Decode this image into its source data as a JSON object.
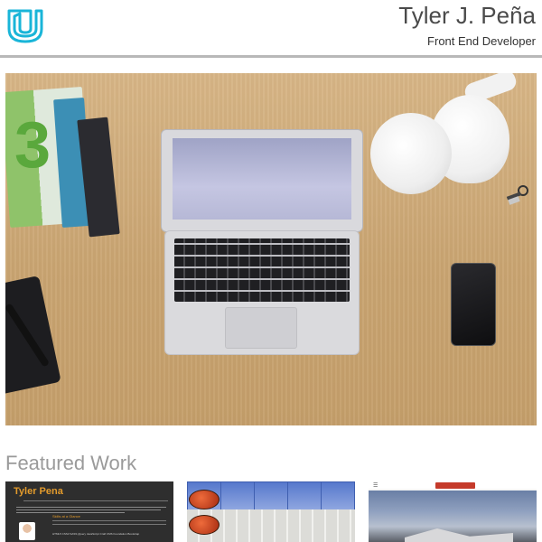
{
  "header": {
    "name": "Tyler J. Peña",
    "role": "Front End Developer",
    "logo_icon": "udacity-logo-icon",
    "accent_color": "#19b5d8"
  },
  "hero": {
    "image_description_icon": "desk-laptop-photo"
  },
  "featured": {
    "title": "Featured Work",
    "cards": [
      {
        "name": "Tyler Pena",
        "skills_heading": "Skills at a Glance",
        "tags": "HTML5 CSS3 SASS jQuery JavaScript Craft CMS Foundation Bootstrap"
      },
      {
        "name": ""
      },
      {
        "menu_icon": "hamburger-menu-icon"
      }
    ]
  }
}
